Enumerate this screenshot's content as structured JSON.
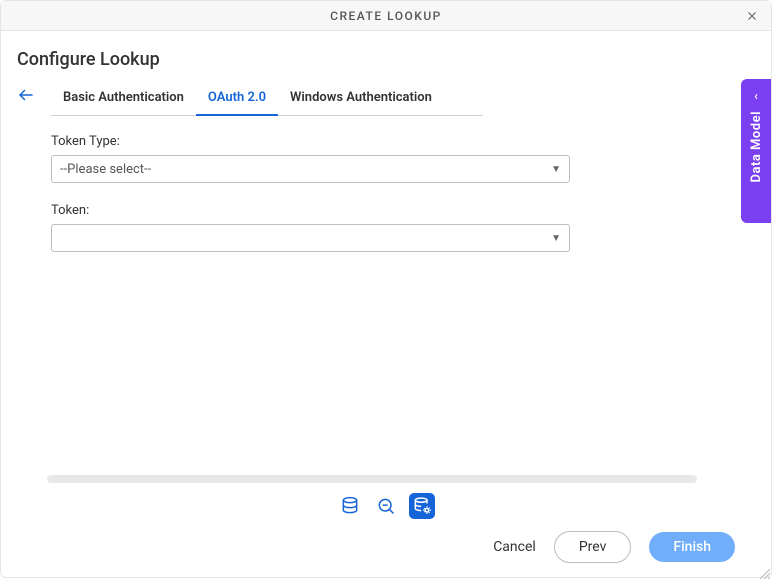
{
  "header": {
    "title": "CREATE LOOKUP"
  },
  "page": {
    "title": "Configure Lookup"
  },
  "tabs": [
    {
      "label": "Basic Authentication",
      "active": false
    },
    {
      "label": "OAuth 2.0",
      "active": true
    },
    {
      "label": "Windows Authentication",
      "active": false
    }
  ],
  "form": {
    "tokenType": {
      "label": "Token Type:",
      "value": "--Please select--"
    },
    "token": {
      "label": "Token:",
      "value": ""
    }
  },
  "sidePanel": {
    "label": "Data Model"
  },
  "stepIcons": [
    {
      "name": "database-icon",
      "active": false
    },
    {
      "name": "search-minus-icon",
      "active": false
    },
    {
      "name": "database-gear-icon",
      "active": true
    }
  ],
  "footer": {
    "cancel": "Cancel",
    "prev": "Prev",
    "finish": "Finish"
  },
  "colors": {
    "primary": "#1565d8",
    "accent": "#7b3ff2",
    "finishBtn": "#70aef9"
  }
}
